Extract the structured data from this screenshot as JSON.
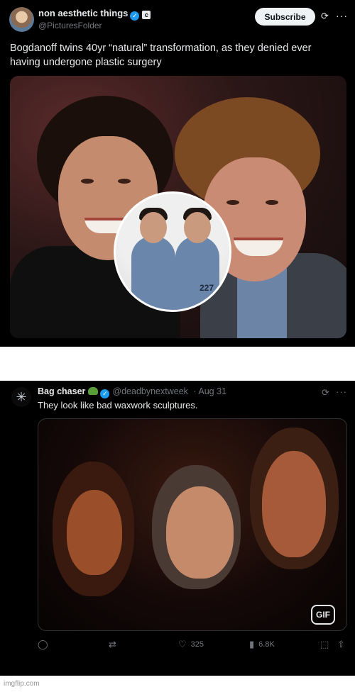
{
  "post1": {
    "display_name": "non aesthetic things",
    "handle": "@PicturesFolder",
    "badge_letter": "c",
    "subscribe_label": "Subscribe",
    "text": "Bogdanoff twins 40yr “natural” transformation, as they denied ever having undergone plastic surgery",
    "inset_number": "227"
  },
  "post2": {
    "display_name": "Bag chaser",
    "handle": "@deadbynextweek",
    "date": "· Aug 31",
    "text": "They look like bad waxwork sculptures.",
    "gif_label": "GIF",
    "actions": {
      "reply_count": "",
      "repost_count": "",
      "like_count": "325",
      "views_count": "6.8K"
    }
  },
  "watermark": "imgflip.com",
  "colors": {
    "background": "#000000",
    "text_primary": "#e7e9ea",
    "text_secondary": "#71767b",
    "verified_blue": "#1d9bf0"
  },
  "icons": [
    "verified-icon",
    "grok-icon",
    "more-icon",
    "reply-icon",
    "repost-icon",
    "like-icon",
    "views-icon",
    "bookmark-icon",
    "share-icon"
  ]
}
